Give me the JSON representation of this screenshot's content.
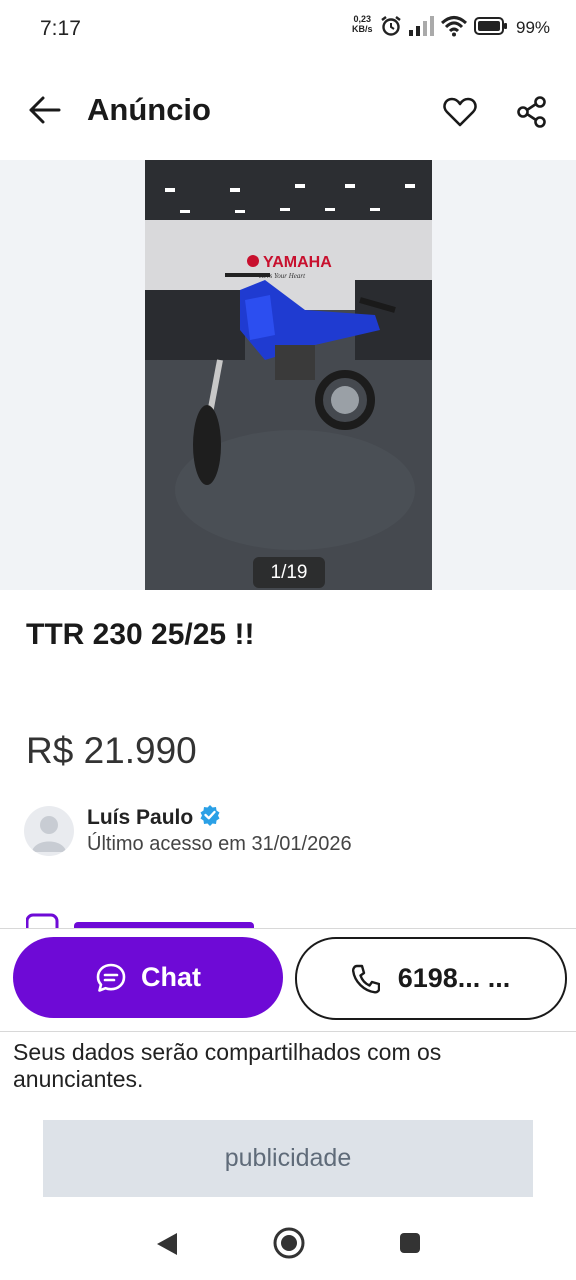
{
  "status_bar": {
    "time": "7:17",
    "speed_value": "0,23",
    "speed_unit": "KB/s",
    "battery": "99%"
  },
  "app_bar": {
    "title": "Anúncio",
    "icons": [
      "back-arrow-icon",
      "heart-icon",
      "share-icon"
    ]
  },
  "gallery": {
    "counter": "1/19",
    "photo_brand": "YAMAHA",
    "photo_tagline": "Revs Your Heart"
  },
  "listing": {
    "title": "TTR 230 25/25 !!",
    "price": "R$ 21.990"
  },
  "seller": {
    "name": "Luís Paulo",
    "verified": true,
    "last_seen": "Último acesso em 31/01/2026"
  },
  "actions": {
    "chat_label": "Chat",
    "phone_label": "6198... ..."
  },
  "disclaimer": "Seus dados serão compartilhados com os anunciantes.",
  "ad_banner": "publicidade",
  "colors": {
    "primary": "#6e0ad6",
    "verified": "#2aa0e6",
    "ad_bg": "#dde2e8"
  }
}
